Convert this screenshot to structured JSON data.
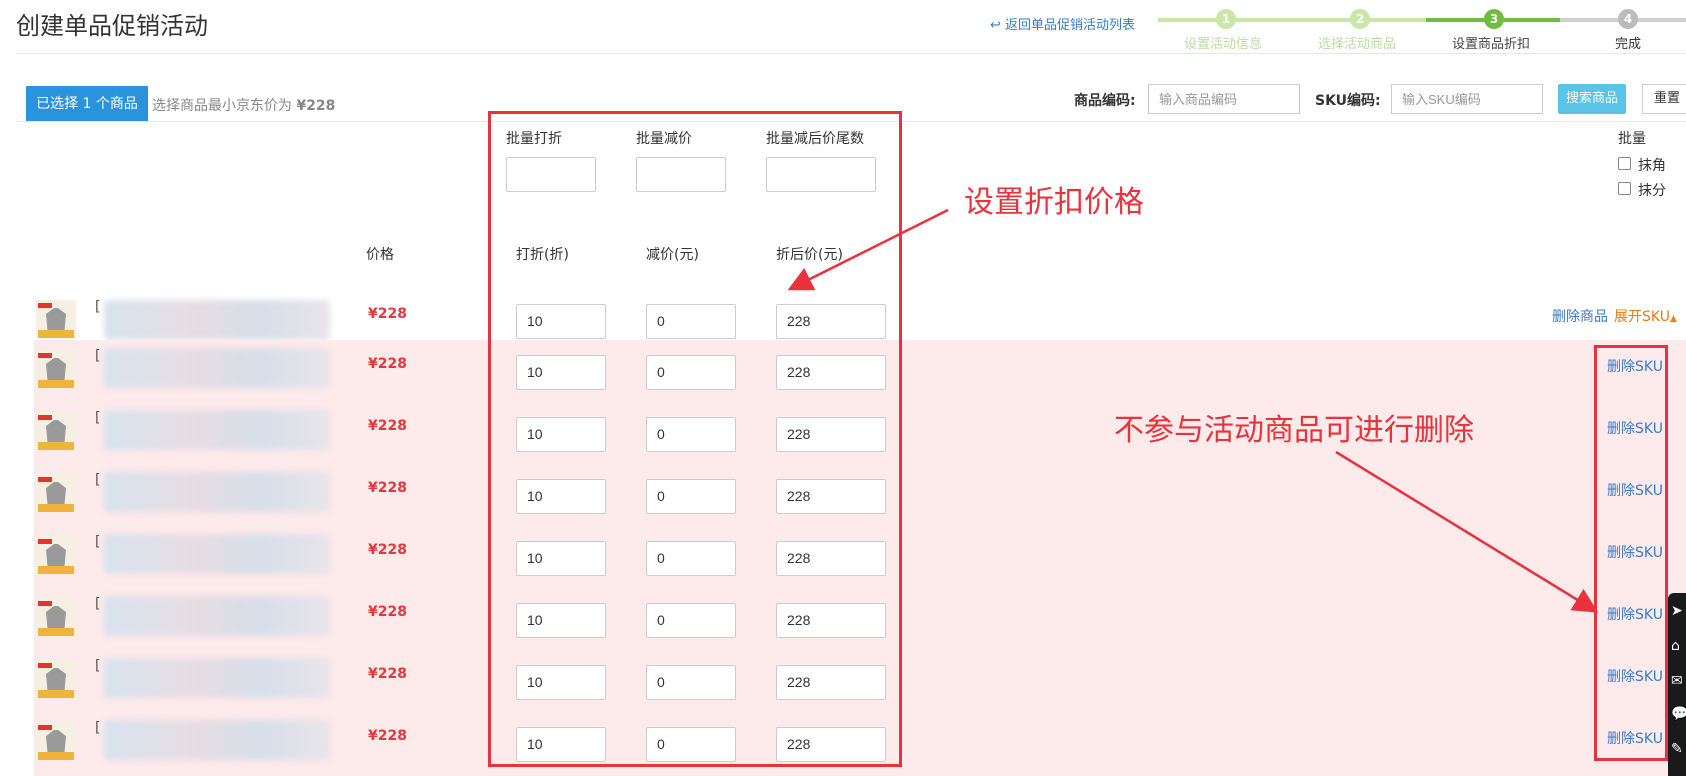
{
  "header": {
    "title": "创建单品促销活动",
    "back_link": "返回单品促销活动列表"
  },
  "steps": [
    {
      "number": "1",
      "label": "设置活动信息",
      "state": "done"
    },
    {
      "number": "2",
      "label": "选择活动商品",
      "state": "done"
    },
    {
      "number": "3",
      "label": "设置商品折扣",
      "state": "current"
    },
    {
      "number": "4",
      "label": "完成",
      "state": "pending"
    }
  ],
  "selection": {
    "selected_label": "已选择 1 个商品",
    "min_price_text": "选择商品最小京东价为",
    "min_price_value": "¥228"
  },
  "search": {
    "product_code_label": "商品编码:",
    "product_code_placeholder": "输入商品编码",
    "sku_code_label": "SKU编码:",
    "sku_code_placeholder": "输入SKU编码",
    "search_button": "搜索商品",
    "reset_button": "重置"
  },
  "bulk": {
    "discount_label": "批量打折",
    "reduce_label": "批量减价",
    "tail_label": "批量减后价尾数",
    "batch_label": "批量",
    "round_jiao": "抹角",
    "round_fen": "抹分"
  },
  "columns": {
    "price": "价格",
    "discount": "打折(折)",
    "reduce": "减价(元)",
    "final_price": "折后价(元)"
  },
  "product": {
    "price": "¥228",
    "discount": "10",
    "reduce": "0",
    "final": "228",
    "delete_product": "删除商品",
    "expand_sku": "展开SKU"
  },
  "skus": [
    {
      "price": "¥228",
      "discount": "10",
      "reduce": "0",
      "final": "228",
      "delete": "删除SKU"
    },
    {
      "price": "¥228",
      "discount": "10",
      "reduce": "0",
      "final": "228",
      "delete": "删除SKU"
    },
    {
      "price": "¥228",
      "discount": "10",
      "reduce": "0",
      "final": "228",
      "delete": "删除SKU"
    },
    {
      "price": "¥228",
      "discount": "10",
      "reduce": "0",
      "final": "228",
      "delete": "删除SKU"
    },
    {
      "price": "¥228",
      "discount": "10",
      "reduce": "0",
      "final": "228",
      "delete": "删除SKU"
    },
    {
      "price": "¥228",
      "discount": "10",
      "reduce": "0",
      "final": "228",
      "delete": "删除SKU"
    },
    {
      "price": "¥228",
      "discount": "10",
      "reduce": "0",
      "final": "228",
      "delete": "删除SKU"
    }
  ],
  "annotations": {
    "discount_note": "设置折扣价格",
    "delete_note": "不参与活动商品可进行删除"
  },
  "colors": {
    "primary": "#2b93dd",
    "step_done": "#c9e8a8",
    "step_current": "#6fbd3f",
    "step_pending": "#bbbbbb",
    "price_red": "#e4393c",
    "annotation_red": "#e8323c",
    "row_highlight": "#fdeaea"
  }
}
